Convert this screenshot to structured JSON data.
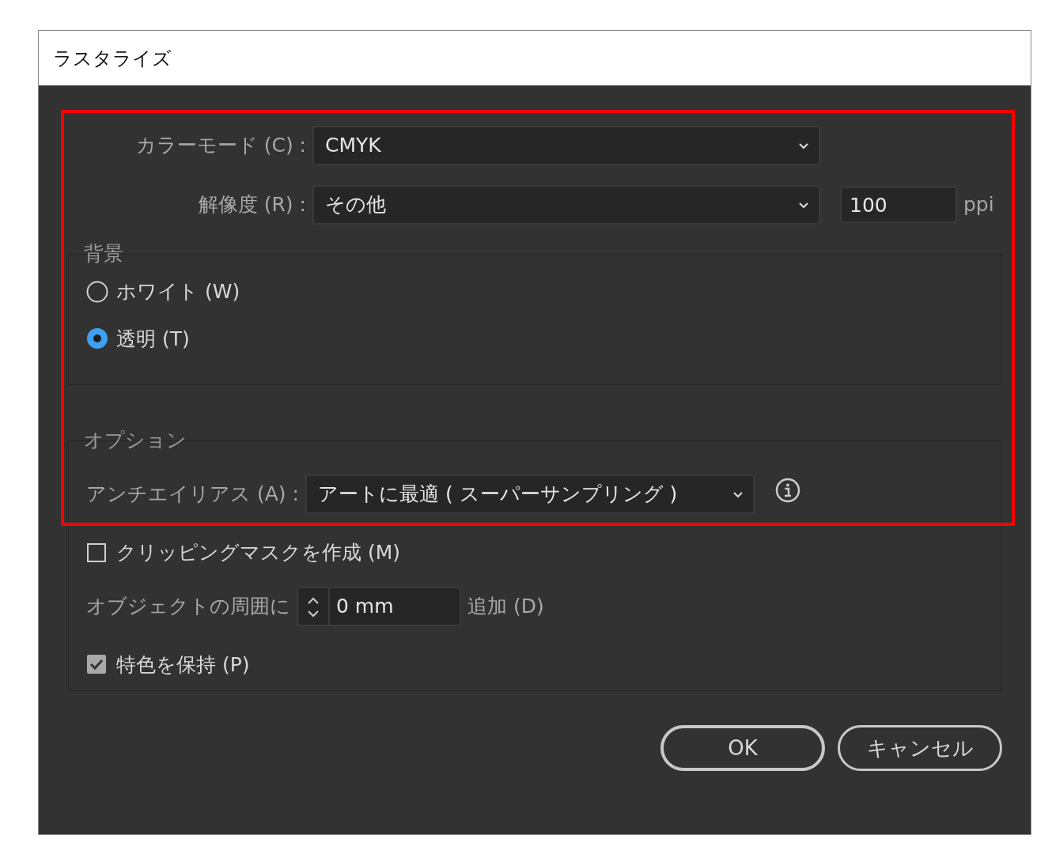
{
  "window": {
    "title": "ラスタライズ"
  },
  "color_mode": {
    "label": "カラーモード (C) :",
    "value": "CMYK"
  },
  "resolution": {
    "label": "解像度 (R) :",
    "value": "その他",
    "ppi_value": "100",
    "unit": "ppi"
  },
  "background": {
    "title": "背景",
    "options": [
      {
        "label": "ホワイト (W)",
        "selected": false
      },
      {
        "label": "透明 (T)",
        "selected": true
      }
    ]
  },
  "options": {
    "title": "オプション",
    "antialias": {
      "label": "アンチエイリアス (A) :",
      "value": "アートに最適 ( スーパーサンプリング )"
    },
    "clipping_mask": {
      "label": "クリッピングマスクを作成 (M)",
      "checked": false
    },
    "add_around": {
      "label": "オブジェクトの周囲に",
      "value": "0 mm",
      "suffix": "追加 (D)"
    },
    "keep_spot_colors": {
      "label": "特色を保持 (P)",
      "checked": true
    }
  },
  "buttons": [
    {
      "label": "OK",
      "kind": "default"
    },
    {
      "label": "キャンセル",
      "kind": "normal"
    }
  ]
}
